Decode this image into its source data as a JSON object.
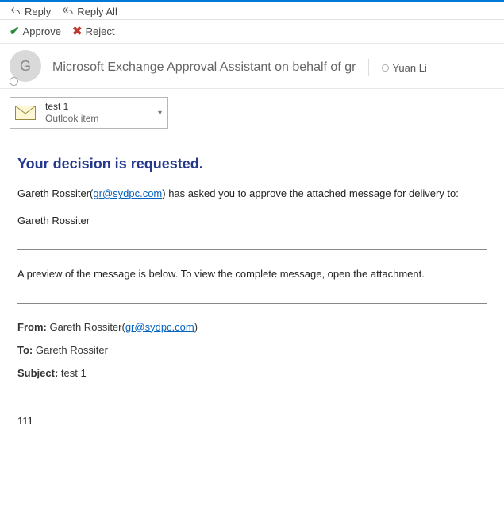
{
  "toolbar": {
    "reply": "Reply",
    "reply_all": "Reply All"
  },
  "vote": {
    "approve": "Approve",
    "reject": "Reject"
  },
  "header": {
    "avatar_initial": "G",
    "from_line": "Microsoft Exchange Approval Assistant on behalf of gr",
    "to_name": "Yuan Li"
  },
  "attachment": {
    "name": "test 1",
    "type": "Outlook item"
  },
  "body": {
    "heading": "Your decision is requested.",
    "requester_name_prefix": "Gareth Rossiter(",
    "requester_email": "gr@sydpc.com",
    "request_text_suffix": ") has asked you to approve the attached message for delivery to:",
    "recipient": "Gareth Rossiter",
    "preview_notice": "A preview of the message is below. To view the complete message, open the attachment."
  },
  "message_preview": {
    "from_label": "From:",
    "from_name_prefix": " Gareth Rossiter(",
    "from_email": "gr@sydpc.com",
    "from_name_suffix": ")",
    "to_label": "To:",
    "to_value": " Gareth Rossiter",
    "subject_label": "Subject:",
    "subject_value": " test 1",
    "content": "111"
  }
}
